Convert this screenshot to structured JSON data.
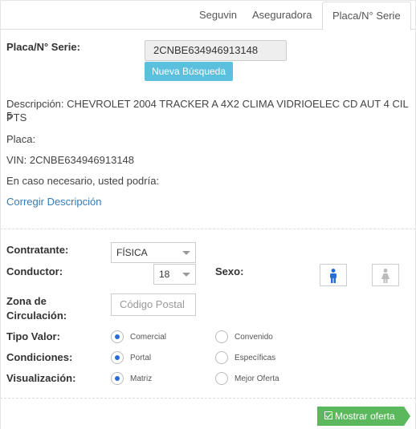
{
  "tabs": [
    {
      "label": "Seguvin"
    },
    {
      "label": "Aseguradora"
    },
    {
      "label": "Placa/N° Serie",
      "active": true
    }
  ],
  "search": {
    "label": "Placa/N° Serie:",
    "value": "2CNBE634946913148",
    "button": "Nueva Búsqueda"
  },
  "vehicle": {
    "descripcion": "Descripción: CHEVROLET 2004 TRACKER A 4X2 CLIMA VIDRIOELEC CD AUT 4 CIL 5 PTS",
    "descripcion_line1": "Descripción: CHEVROLET 2004 TRACKER A 4X2 CLIMA VIDRIOELEC CD AUT 4 CIL 5",
    "descripcion_line2": "PTS",
    "placa": "Placa:",
    "vin": "VIN: 2CNBE634946913148",
    "note": "En caso necesario, usted podría:",
    "link": "Corregir Descripción"
  },
  "form": {
    "contratante_label": "Contratante:",
    "contratante_value": "FÍSICA",
    "conductor_label": "Conductor:",
    "conductor_value": "18",
    "sexo_label": "Sexo:",
    "zona_label_1": "Zona de",
    "zona_label_2": "Circulación:",
    "codigo_postal_placeholder": "Código Postal",
    "tipo_valor_label": "Tipo Valor:",
    "tipo_valor_options": [
      "Comercial",
      "Convenido"
    ],
    "condiciones_label": "Condiciones:",
    "condiciones_options": [
      "Portal",
      "Específicas"
    ],
    "visualizacion_label": "Visualización:",
    "visualizacion_options": [
      "Matriz",
      "Mejor Oferta"
    ]
  },
  "actions": {
    "mostrar": "Mostrar oferta"
  },
  "colors": {
    "info_button": "#5bc0de",
    "success_button": "#5cb85c",
    "link": "#337ab7",
    "male_icon": "#2a6cd6",
    "female_icon": "#bbbbbb",
    "radio_selected": "#2a6cd6"
  }
}
